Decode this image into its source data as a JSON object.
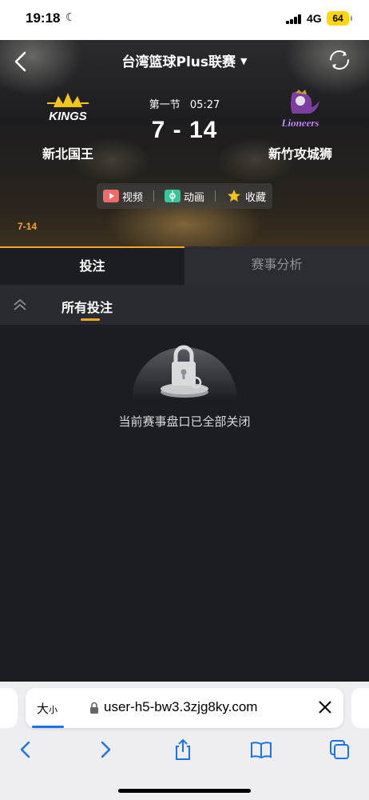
{
  "status_bar": {
    "time": "19:18",
    "network": "4G",
    "battery": "64"
  },
  "header": {
    "league_title": "台湾篮球Plus联赛"
  },
  "match": {
    "period": "第一节",
    "clock": "05:27",
    "score": "7 - 14",
    "mini_score": "7-14",
    "home_team": {
      "name": "新北国王",
      "logo_text": "KINGS"
    },
    "away_team": {
      "name": "新竹攻城狮",
      "logo_text": "Lioneers"
    }
  },
  "actions": {
    "video": "视频",
    "animation": "动画",
    "favorite": "收藏"
  },
  "tabs": [
    {
      "label": "投注",
      "active": true
    },
    {
      "label": "赛事分析",
      "active": false
    }
  ],
  "subnav": {
    "label": "所有投注"
  },
  "empty_state": {
    "message": "当前赛事盘口已全部关闭"
  },
  "browser": {
    "text_size_label": "大",
    "text_size_small": "小",
    "url": "user-h5-bw3.3zjg8ky.com"
  },
  "colors": {
    "accent": "#f5a623",
    "background": "#1c1d22",
    "browser_link": "#1a73e8"
  }
}
